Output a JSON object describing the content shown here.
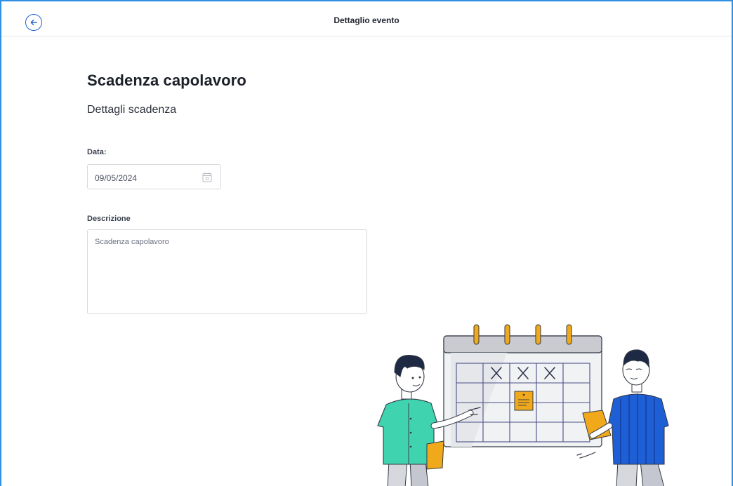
{
  "header": {
    "title": "Dettaglio evento",
    "back_icon": "arrow-left-circle-icon"
  },
  "main": {
    "title": "Scadenza capolavoro",
    "subtitle": "Dettagli scadenza",
    "date_field": {
      "label": "Data:",
      "value": "09/05/2024",
      "icon": "calendar-icon"
    },
    "description_field": {
      "label": "Descrizione",
      "value": "Scadenza capolavoro"
    }
  },
  "colors": {
    "accent": "#1f62d6",
    "frame": "#2f8fe3",
    "calendar_rings": "#f0a91b",
    "shirt_left": "#3fd3b0",
    "shirt_right": "#1f5fd6"
  }
}
